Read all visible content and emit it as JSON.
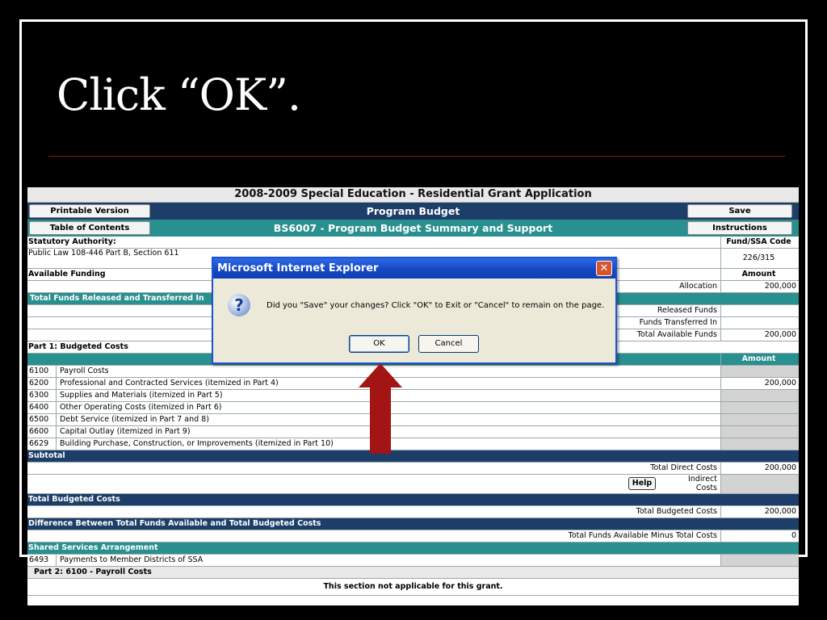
{
  "slide": {
    "title": "Click “OK”."
  },
  "app": {
    "title": "2008-2009 Special Education - Residential Grant Application",
    "buttons": {
      "printable": "Printable Version",
      "toc": "Table of Contents",
      "save": "Save",
      "instructions": "Instructions"
    },
    "header_navy": "Program Budget",
    "header_teal": "BS6007 - Program Budget Summary and Support",
    "statutory": {
      "label": "Statutory Authority:",
      "law": "Public Law 108-446 Part B, Section 611",
      "fund_header": "Fund/SSA Code",
      "fund_code": "226/315"
    },
    "available": {
      "label": "Available Funding",
      "amount_header": "Amount",
      "allocation_label": "Allocation",
      "allocation_value": "200,000"
    },
    "released": {
      "label": "Total Funds Released and Transferred In",
      "released_label": "Released Funds",
      "transferred_label": "Funds Transferred In",
      "total_label": "Total Available Funds",
      "total_value": "200,000"
    },
    "part1": {
      "label": "Part 1: Budgeted Costs",
      "amount_header": "Amount",
      "rows": [
        {
          "code": "6100",
          "desc": "Payroll Costs",
          "amount": ""
        },
        {
          "code": "6200",
          "desc": "Professional and Contracted Services (itemized in Part 4)",
          "amount": "200,000"
        },
        {
          "code": "6300",
          "desc": "Supplies and Materials (itemized in Part 5)",
          "amount": ""
        },
        {
          "code": "6400",
          "desc": "Other Operating Costs (itemized in Part 6)",
          "amount": ""
        },
        {
          "code": "6500",
          "desc": "Debt Service (itemized in Part 7 and 8)",
          "amount": ""
        },
        {
          "code": "6600",
          "desc": "Capital Outlay (itemized in Part 9)",
          "amount": ""
        },
        {
          "code": "6629",
          "desc": "Building Purchase, Construction, or Improvements (itemized in Part 10)",
          "amount": ""
        }
      ]
    },
    "subtotal": {
      "label": "Subtotal",
      "direct_label": "Total Direct Costs",
      "direct_value": "200,000",
      "help": "Help",
      "indirect_label_1": "Indirect",
      "indirect_label_2": "Costs"
    },
    "budgeted": {
      "label": "Total Budgeted Costs",
      "row_label": "Total Budgeted Costs",
      "value": "200,000"
    },
    "difference": {
      "label": "Difference Between Total Funds Available and Total Budgeted Costs",
      "row_label": "Total Funds Available Minus Total Costs",
      "value": "0"
    },
    "shared": {
      "label": "Shared Services Arrangement",
      "code": "6493",
      "desc": "Payments to Member Districts of SSA"
    },
    "part2": {
      "label": "Part 2: 6100 - Payroll Costs",
      "note": "This section not applicable for this grant."
    }
  },
  "dialog": {
    "title": "Microsoft Internet Explorer",
    "close": "✕",
    "icon": "?",
    "message": "Did you \"Save\" your changes? Click \"OK\" to Exit or \"Cancel\" to remain on the page.",
    "ok": "OK",
    "cancel": "Cancel"
  },
  "colors": {
    "navy": "#1d3e68",
    "teal": "#2a8f8f",
    "arrow": "#a31515",
    "dialog_title": "#1548c2"
  }
}
